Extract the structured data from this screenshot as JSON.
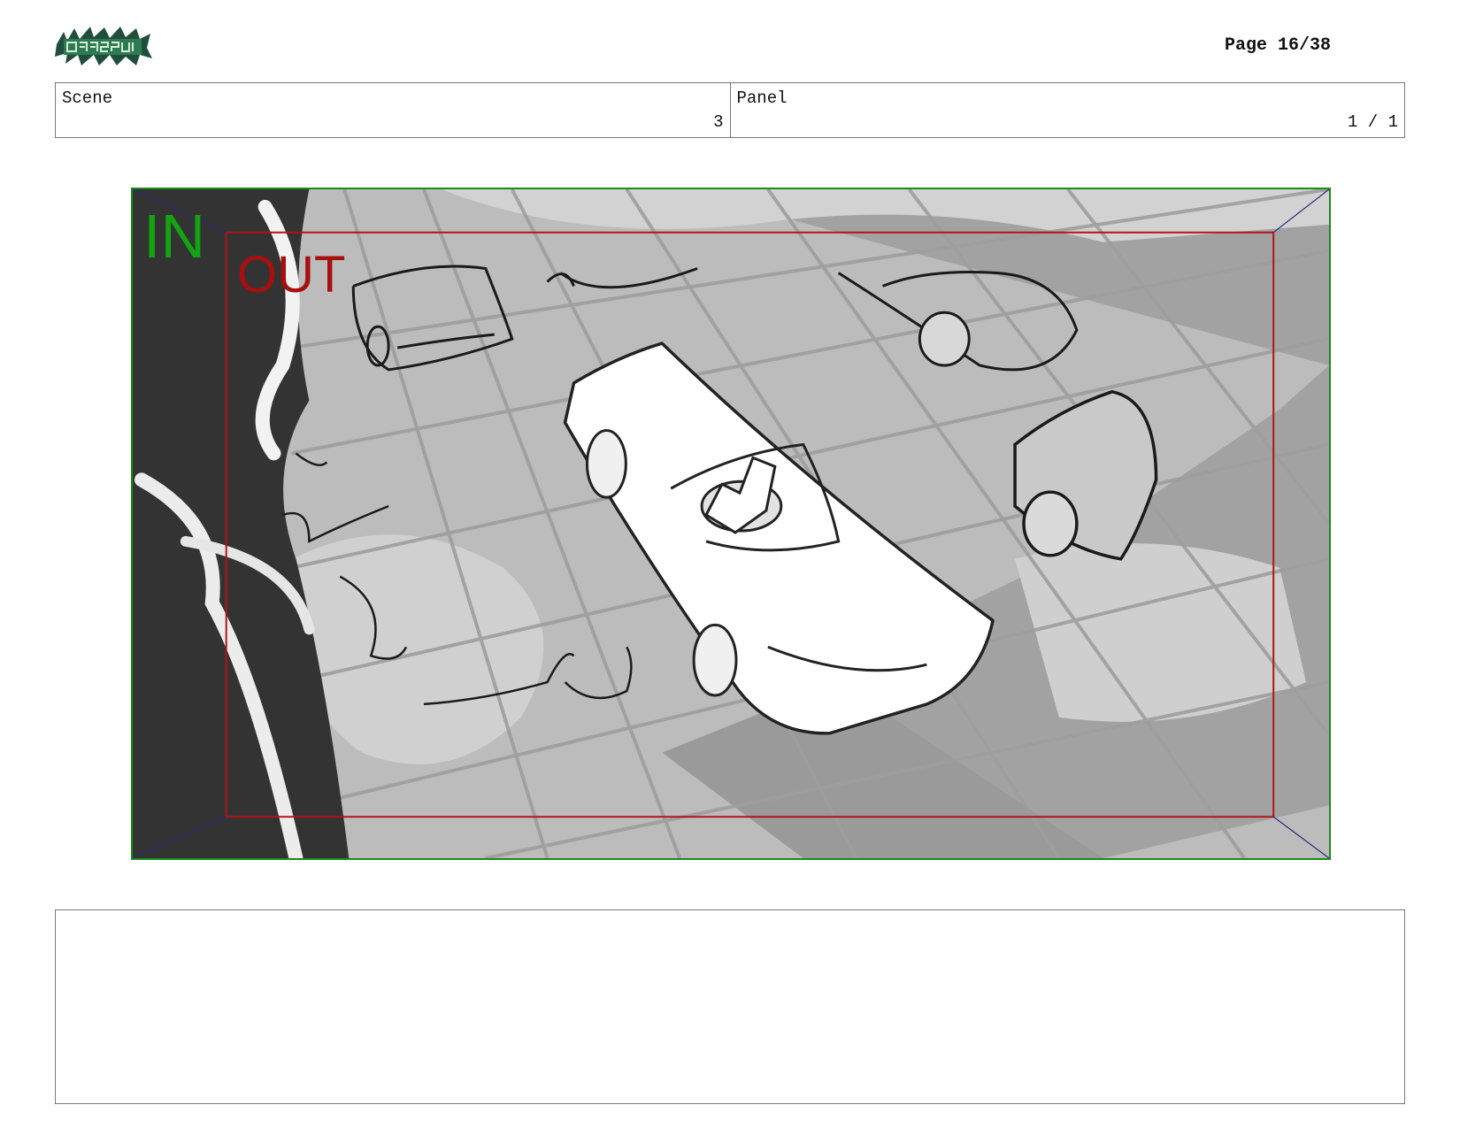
{
  "header": {
    "page_label": "Page 16/38",
    "logo_icon": "offspring-logo-icon"
  },
  "info": {
    "scene_label": "Scene",
    "scene_value": "3",
    "panel_label": "Panel",
    "panel_value": "1 / 1"
  },
  "frame": {
    "in_label": "IN",
    "out_label": "OUT",
    "in_color": "#13a313",
    "out_color": "#a80f0f"
  },
  "notes": {
    "text": ""
  }
}
